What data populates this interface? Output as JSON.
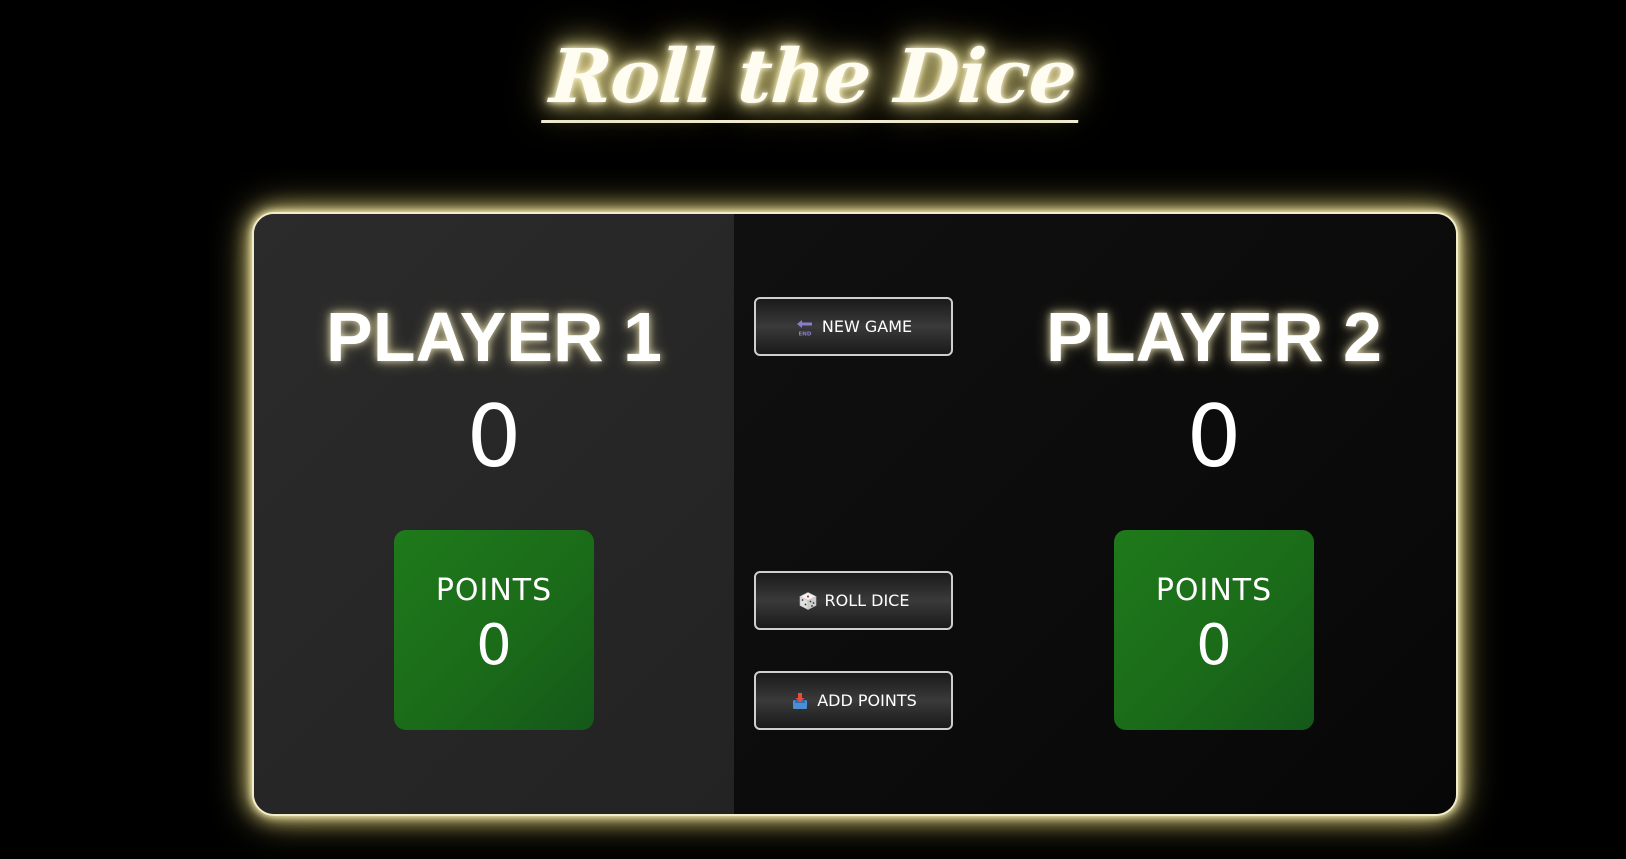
{
  "title": "Roll the Dice",
  "players": [
    {
      "name": "PLAYER 1",
      "score": "0",
      "points_label": "POINTS",
      "points": "0"
    },
    {
      "name": "PLAYER 2",
      "score": "0",
      "points_label": "POINTS",
      "points": "0"
    }
  ],
  "controls": {
    "new_game": {
      "label": "NEW GAME",
      "icon": "end-arrow-icon"
    },
    "roll_dice": {
      "label": "ROLL DICE",
      "icon": "dice-icon"
    },
    "add_points": {
      "label": "ADD POINTS",
      "icon": "inbox-tray-icon"
    }
  },
  "colors": {
    "background": "#000000",
    "glow": "#f3e8a8",
    "points_box": "#1e7a1a",
    "active_panel": "#2b2b2b",
    "inactive_panel": "#0b0b0b"
  }
}
